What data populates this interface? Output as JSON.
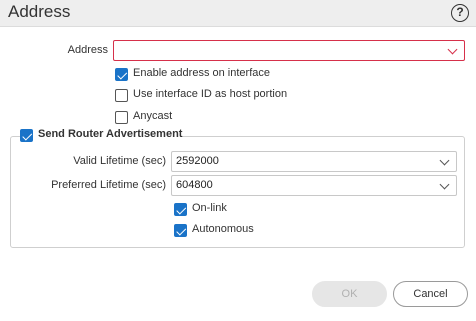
{
  "dialog": {
    "title": "Address",
    "help_symbol": "?"
  },
  "form": {
    "address": {
      "label": "Address",
      "value": ""
    },
    "enable_address": {
      "label": "Enable address on interface",
      "checked": true
    },
    "use_interface_id": {
      "label": "Use interface ID as host portion",
      "checked": false
    },
    "anycast": {
      "label": "Anycast",
      "checked": false
    },
    "send_router_adv": {
      "label": "Send Router Advertisement",
      "checked": true,
      "valid_lifetime": {
        "label": "Valid Lifetime (sec)",
        "value": "2592000"
      },
      "preferred_lifetime": {
        "label": "Preferred Lifetime (sec)",
        "value": "604800"
      },
      "on_link": {
        "label": "On-link",
        "checked": true
      },
      "autonomous": {
        "label": "Autonomous",
        "checked": true
      }
    }
  },
  "buttons": {
    "ok_label": "OK",
    "cancel_label": "Cancel"
  },
  "colors": {
    "accent": "#1a73c8",
    "error_border": "#d6304a",
    "disabled_button": "#e6e6e6"
  }
}
